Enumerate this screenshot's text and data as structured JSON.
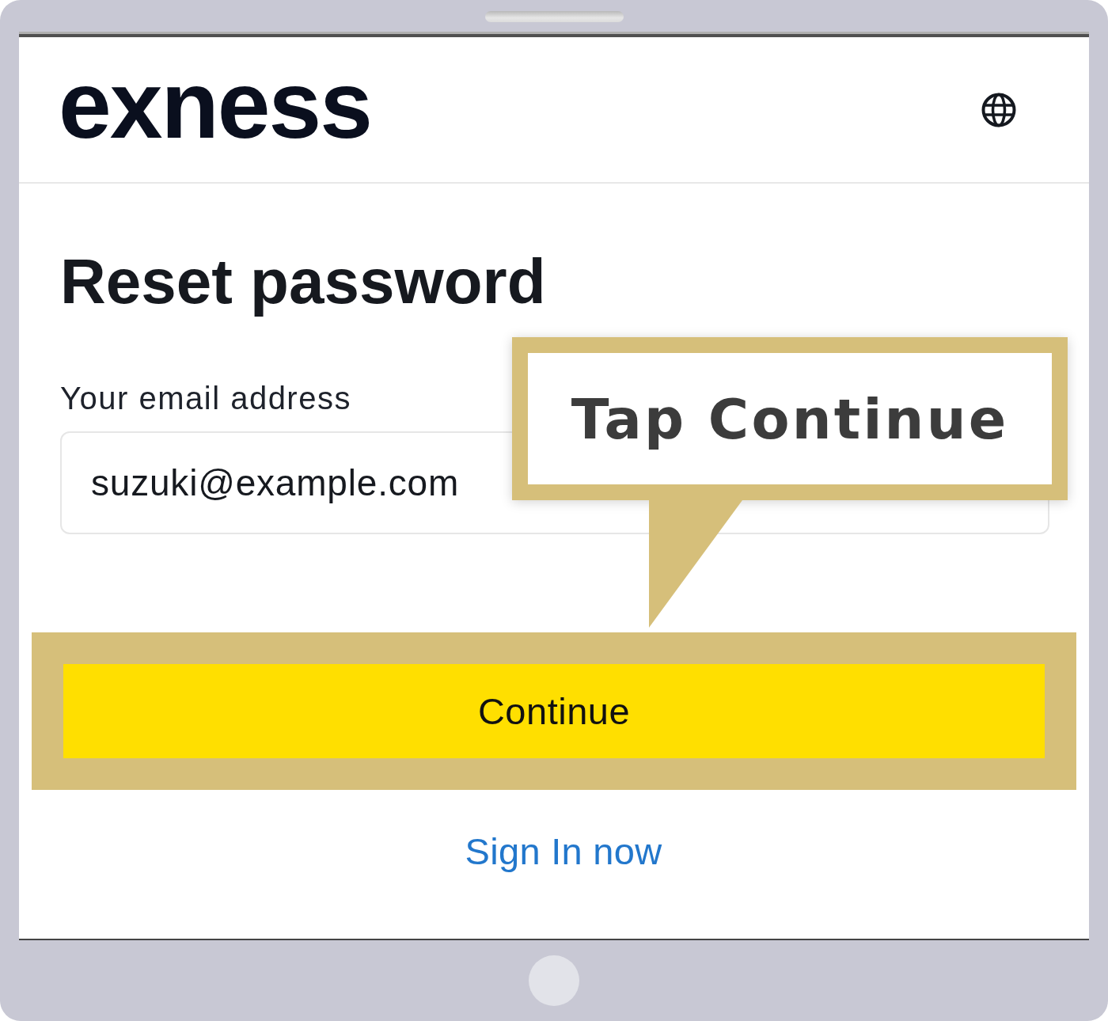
{
  "logo": {
    "text": "exness"
  },
  "title": "Reset password",
  "email_field": {
    "label": "Your email address",
    "value": "suzuki@example.com"
  },
  "continue_button": {
    "label": "Continue",
    "highlighted": true
  },
  "sign_in_link": "Sign In now",
  "callout": {
    "text": "Tap Continue"
  }
}
